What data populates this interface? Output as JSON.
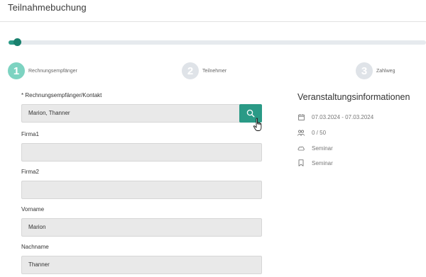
{
  "header": {
    "title": "Teilnahmebuchung"
  },
  "progress": {
    "value_percent": 2
  },
  "steps": [
    {
      "number": "1",
      "label": "Rechnungsempfänger",
      "state": "active"
    },
    {
      "number": "2",
      "label": "Teilnehmer",
      "state": "inactive"
    },
    {
      "number": "3",
      "label": "Zahlweg",
      "state": "inactive"
    }
  ],
  "form": {
    "recipient": {
      "label": "* Rechnungsempfänger/Kontakt",
      "value": "Marion, Thanner"
    },
    "firma1": {
      "label": "Firma1",
      "value": ""
    },
    "firma2": {
      "label": "Firma2",
      "value": ""
    },
    "vorname": {
      "label": "Vorname",
      "value": "Marion"
    },
    "nachname": {
      "label": "Nachname",
      "value": "Thanner"
    }
  },
  "event_info": {
    "title": "Veranstaltungsinformationen",
    "dates": "07.03.2024 - 07.03.2024",
    "participants": "0 / 50",
    "type": "Seminar",
    "category": "Seminar"
  },
  "colors": {
    "accent": "#2a9a86",
    "step_active": "#7dd3c1",
    "step_inactive": "#dfe3e8",
    "field_bg": "#e9e9e9"
  }
}
